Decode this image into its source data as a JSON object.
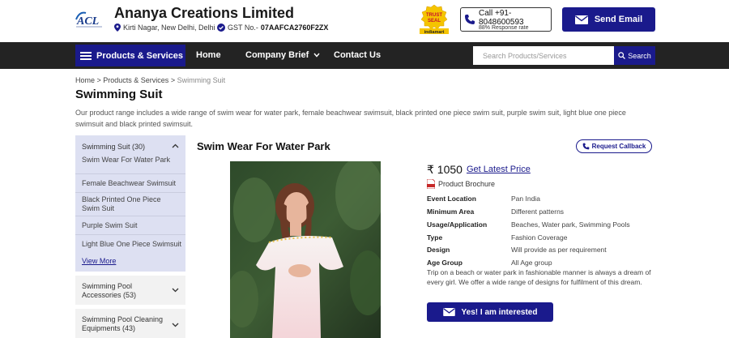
{
  "header": {
    "company_name": "Ananya Creations Limited",
    "location": "Kirti Nagar, New Delhi, Delhi",
    "gst_label": "GST No.-",
    "gst_number": "07AAFCA2760F2ZX",
    "call_line1": "Call +91-",
    "call_line2": "8048600593",
    "response_rate": "88% Response rate",
    "send_email_label": "Send Email"
  },
  "nav": {
    "products_label": "Products & Services",
    "items": [
      "Home",
      "Company Brief",
      "Contact Us"
    ],
    "search_placeholder": "Search Products/Services",
    "search_label": "Search"
  },
  "breadcrumb": {
    "home": "Home",
    "products": "Products & Services",
    "current": "Swimming Suit"
  },
  "page": {
    "title": "Swimming Suit",
    "description": "Our product range includes a wide range of swim wear for water park, female beachwear swimsuit, black printed one piece swim suit, purple swim suit, light blue one piece swimsuit and black printed swimsuit."
  },
  "sidebar": {
    "heading": "Swimming Suit (30)",
    "items": [
      "Swim Wear For Water Park",
      "Female Beachwear Swimsuit",
      "Black Printed One Piece Swim Suit",
      "Purple Swim Suit",
      "Light Blue One Piece Swimsuit"
    ],
    "view_more": "View More",
    "categories": [
      "Swimming Pool Accessories (53)",
      "Swimming Pool Cleaning Equipments (43)"
    ]
  },
  "product": {
    "title": "Swim Wear For Water Park",
    "request_callback": "Request Callback",
    "price": "₹ 1050",
    "latest_price_label": "Get Latest Price",
    "brochure": "Product Brochure",
    "specs": [
      {
        "label": "Event Location",
        "value": "Pan India"
      },
      {
        "label": "Minimum Area",
        "value": "Different patterns"
      },
      {
        "label": "Usage/Application",
        "value": "Beaches, Water park, Swimming Pools"
      },
      {
        "label": "Type",
        "value": "Fashion Coverage"
      },
      {
        "label": "Design",
        "value": "Will provide as per requirement"
      },
      {
        "label": "Age Group",
        "value": "All Age group"
      }
    ],
    "description": "Trip on a beach or water park in fashionable manner is always a dream of every girl. We offer a wide range of designs for fulfilment of this dream.",
    "interest_label": "Yes! I am interested"
  },
  "badges": {
    "trust_line1": "TRUST",
    "trust_line2": "SEAL",
    "trust_line3": "indiamart",
    "logo_text": "ACL"
  },
  "colors": {
    "brand": "#1a1a8c",
    "nav_bg": "#232323",
    "sidebar_bg": "#dde0f2"
  }
}
